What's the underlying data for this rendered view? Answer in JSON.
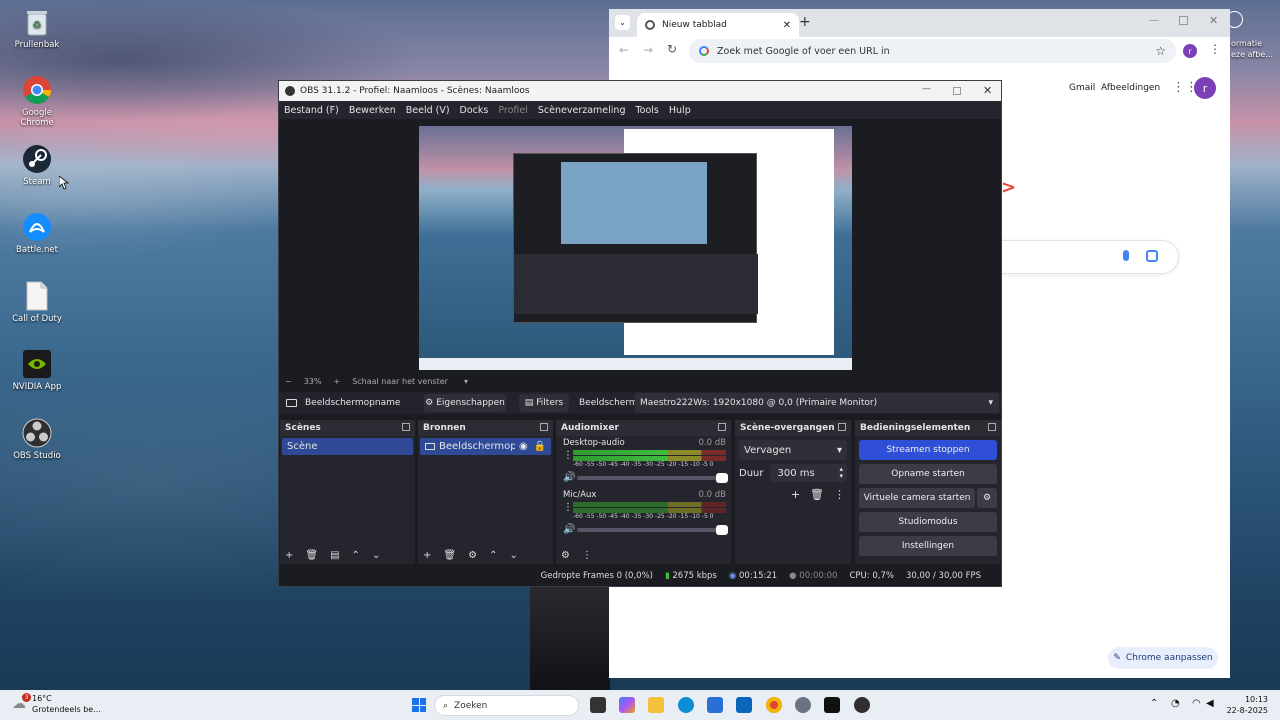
{
  "desktop": {
    "icons": [
      {
        "label": "Prullenbak"
      },
      {
        "label": "Google Chrome"
      },
      {
        "label": "Steam"
      },
      {
        "label": "Battle.net"
      },
      {
        "label": "Call of Duty"
      },
      {
        "label": "NVIDIA App"
      },
      {
        "label": "OBS Studio"
      }
    ],
    "side_text_1": "ormatie",
    "side_text_2": "eze afbe..."
  },
  "chrome": {
    "tab_title": "Nieuw tabblad",
    "new_tab_symbol": "+",
    "omnibox_placeholder": "Zoek met Google of voer een URL in",
    "profile_initial": "r",
    "gmail_link": "Gmail",
    "images_link": "Afbeeldingen",
    "customize_button": "Chrome aanpassen",
    "brand_color": "#1a73e8"
  },
  "obs": {
    "title": "OBS 31.1.2 - Profiel: Naamloos - Scènes: Naamloos",
    "menu": [
      "Bestand (F)",
      "Bewerken",
      "Beeld (V)",
      "Docks",
      "Profiel",
      "Scèneverzameling",
      "Tools",
      "Hulp"
    ],
    "zoom": {
      "minus": "−",
      "value": "33%",
      "plus": "+",
      "mode": "Schaal naar het venster"
    },
    "source_bar": {
      "source_name": "Beeldschermopname",
      "properties_button": "Eigenschappen",
      "filters_button": "Filters",
      "display_label": "Beeldscherm",
      "display_value": "Maestro222Ws: 1920x1080 @ 0,0 (Primaire Monitor)"
    },
    "scenes": {
      "title": "Scènes",
      "items": [
        "Scène"
      ]
    },
    "sources": {
      "title": "Bronnen",
      "items": [
        "Beeldschermopname"
      ]
    },
    "audio": {
      "title": "Audiomixer",
      "channels": [
        {
          "name": "Desktop-audio",
          "db": "0.0 dB",
          "level": 0.7
        },
        {
          "name": "Mic/Aux",
          "db": "0.0 dB",
          "level": 0.0
        }
      ],
      "scale": "-60 -55 -50 -45 -40 -35 -30 -25 -20 -15 -10 -5 0"
    },
    "transitions": {
      "title": "Scène-overgangen",
      "type": "Vervagen",
      "duration_label": "Duur",
      "duration_value": "300 ms"
    },
    "controls": {
      "title": "Bedieningselementen",
      "stream_button": "Streamen stoppen",
      "record_button": "Opname starten",
      "virtual_cam_button": "Virtuele camera starten",
      "studio_button": "Studiomodus",
      "settings_button": "Instellingen",
      "accent_color": "#2f4fd6"
    },
    "status": {
      "dropped_frames": "Gedropte Frames 0 (0,0%)",
      "bitrate": "2675 kbps",
      "stream_time": "00:15:21",
      "record_time": "00:00:00",
      "cpu": "CPU: 0,7%",
      "fps": "30,00 / 30,00 FPS"
    }
  },
  "taskbar": {
    "weather_temp": "16°C",
    "weather_desc": "Grotendeels be...",
    "weather_badge": "3",
    "search_placeholder": "Zoeken",
    "time": "10:13",
    "date": "22-8-2025"
  }
}
